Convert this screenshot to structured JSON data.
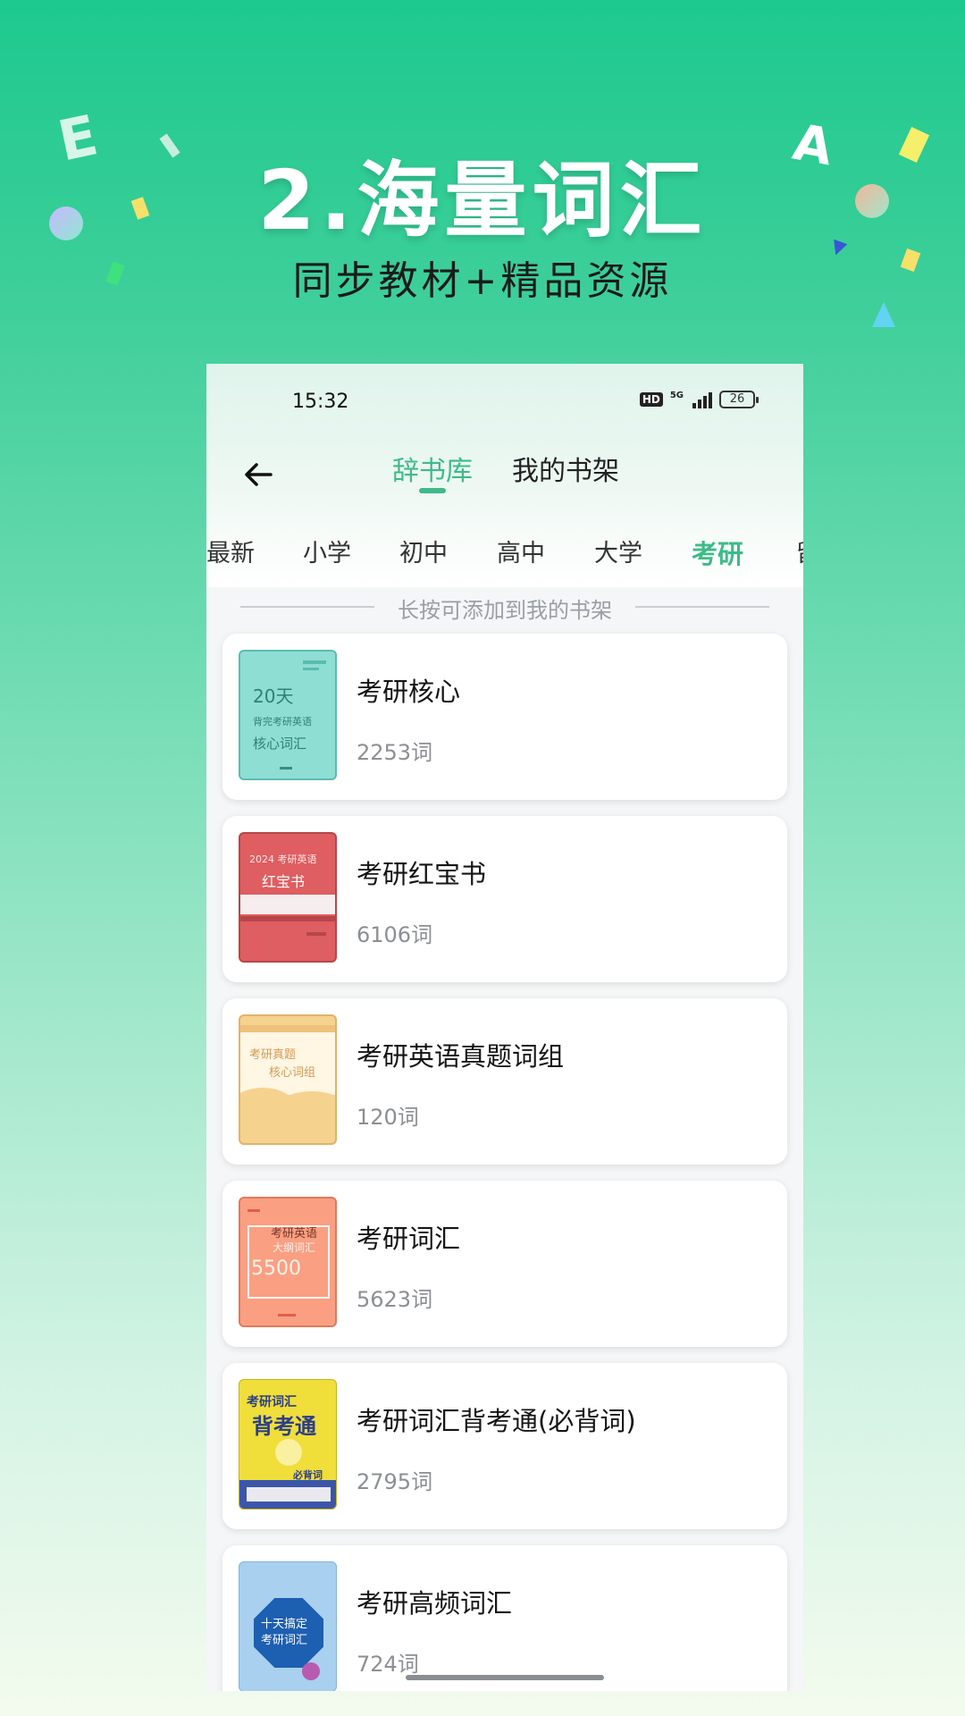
{
  "headline": "2.海量词汇",
  "subline": "同步教材+精品资源",
  "decor": {
    "letter_e": "E",
    "letter_a": "A"
  },
  "status_bar": {
    "time": "15:32",
    "hd": "HD",
    "network": "5G",
    "battery": "26"
  },
  "header": {
    "tabs": [
      {
        "label": "辞书库",
        "active": true
      },
      {
        "label": "我的书架",
        "active": false
      }
    ]
  },
  "categories": [
    {
      "label": "最新",
      "active": false
    },
    {
      "label": "小学",
      "active": false
    },
    {
      "label": "初中",
      "active": false
    },
    {
      "label": "高中",
      "active": false
    },
    {
      "label": "大学",
      "active": false
    },
    {
      "label": "考研",
      "active": true
    },
    {
      "label": "留",
      "active": false
    }
  ],
  "hint": "长按可添加到我的书架",
  "books": [
    {
      "title": "考研核心",
      "count": "2253词",
      "cover_lines": [
        "20天",
        "背完考研英语",
        "核心词汇"
      ],
      "cover_color": "#8fded3"
    },
    {
      "title": "考研红宝书",
      "count": "6106词",
      "cover_lines": [
        "2024 考研英语",
        "红宝书"
      ],
      "cover_color": "#de5e61"
    },
    {
      "title": "考研英语真题词组",
      "count": "120词",
      "cover_lines": [
        "考研真题",
        "核心词组"
      ],
      "cover_color": "#f6d28f"
    },
    {
      "title": "考研词汇",
      "count": "5623词",
      "cover_lines": [
        "考研英语",
        "大纲词汇",
        "5500"
      ],
      "cover_color": "#fa9f82"
    },
    {
      "title": "考研词汇背考通(必背词)",
      "count": "2795词",
      "cover_lines": [
        "考研词汇",
        "背考通",
        "必背词"
      ],
      "cover_color": "#f0de3a"
    },
    {
      "title": "考研高频词汇",
      "count": "724词",
      "cover_lines": [
        "十天搞定",
        "考研词汇"
      ],
      "cover_color": "#a9d0ef"
    }
  ]
}
